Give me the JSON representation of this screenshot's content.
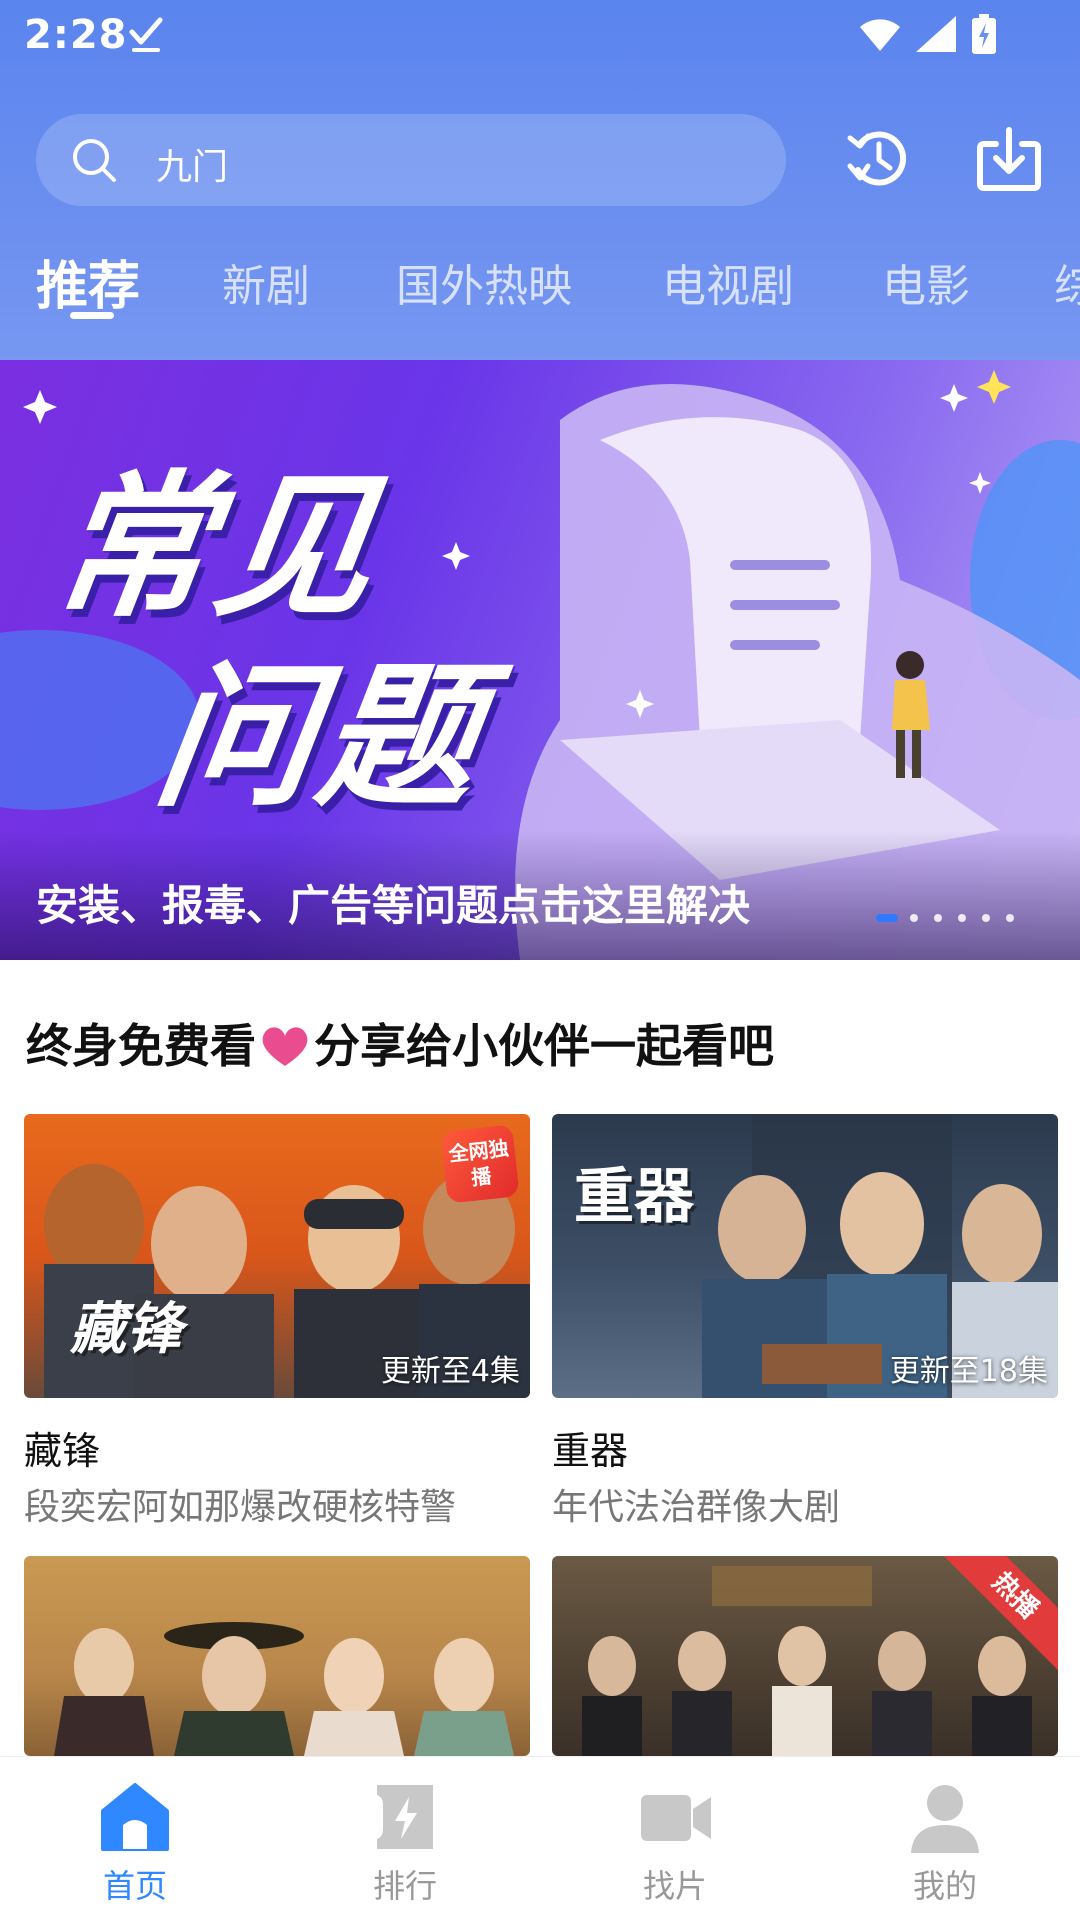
{
  "status_bar": {
    "time": "2:28"
  },
  "search": {
    "text": "九门"
  },
  "tabs": [
    {
      "label": "推荐",
      "active": true
    },
    {
      "label": "新剧"
    },
    {
      "label": "国外热映"
    },
    {
      "label": "电视剧"
    },
    {
      "label": "电影"
    },
    {
      "label": "综"
    }
  ],
  "banner": {
    "headline_line1": "常见",
    "headline_line2": "问题",
    "caption": "安装、报毒、广告等问题点击这里解决",
    "active_dot": 1,
    "dot_count": 6
  },
  "section": {
    "title_part1": "终身免费看",
    "title_part2": "分享给小伙伴一起看吧"
  },
  "cards": [
    {
      "title": "藏锋",
      "subtitle": "段奕宏阿如那爆改硬核特警",
      "badge": "更新至4集",
      "poster_text": "藏锋",
      "tag": "全网独播"
    },
    {
      "title": "重器",
      "subtitle": "年代法治群像大剧",
      "badge": "更新至18集",
      "poster_text": "重器"
    },
    {
      "title": "",
      "subtitle": "",
      "badge": ""
    },
    {
      "title": "",
      "subtitle": "",
      "badge": "",
      "tag": "热播"
    }
  ],
  "bottom_nav": [
    {
      "label": "首页",
      "icon": "home-icon",
      "active": true
    },
    {
      "label": "排行",
      "icon": "ranking-icon"
    },
    {
      "label": "找片",
      "icon": "video-camera-icon"
    },
    {
      "label": "我的",
      "icon": "profile-icon"
    }
  ],
  "colors": {
    "header": "#6b8ff0",
    "accent": "#2f88ff",
    "hot": "#e23b3b"
  }
}
